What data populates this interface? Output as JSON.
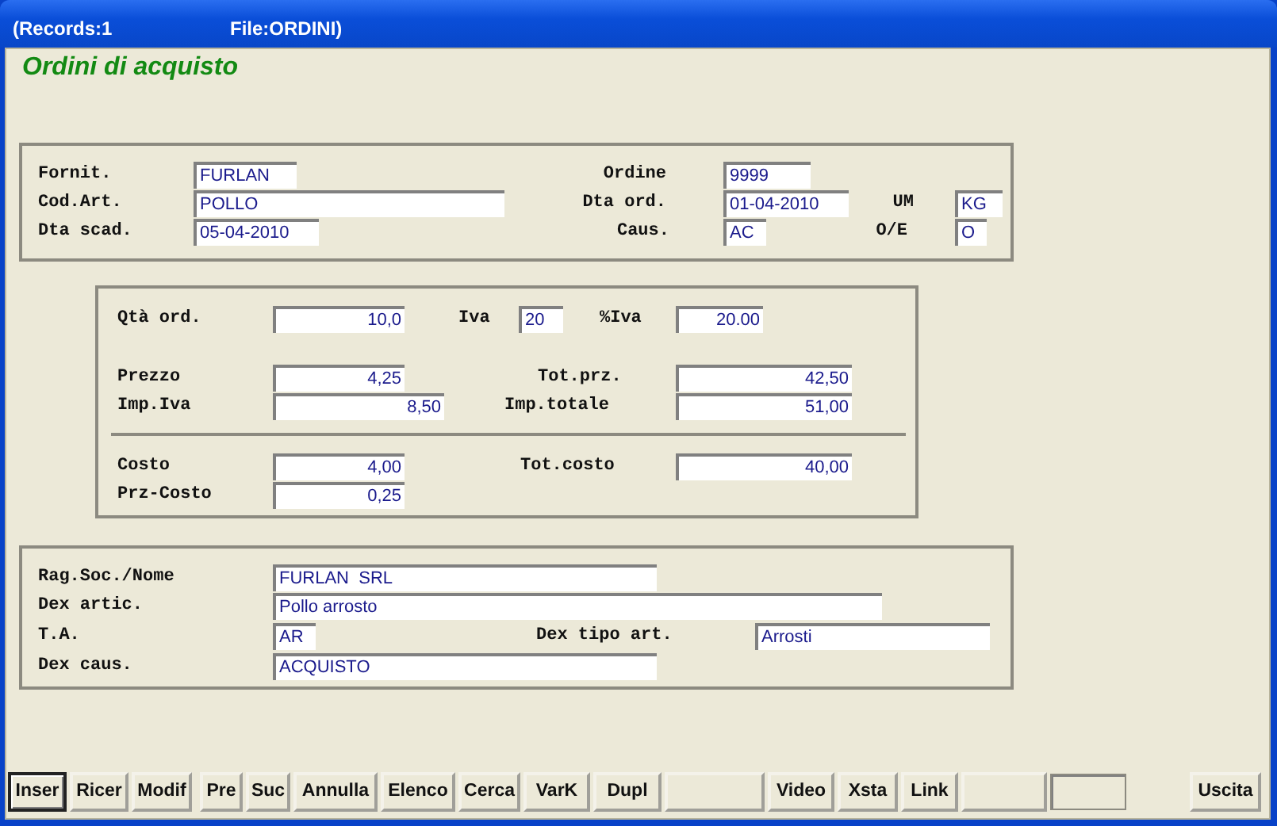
{
  "window": {
    "title_left": "(Records:1",
    "title_right": "File:ORDINI)"
  },
  "heading": "Ordini di acquisto",
  "header_fields": [
    {
      "label": "Fornit.",
      "value": "FURLAN"
    },
    {
      "label": "Ordine",
      "value": "9999"
    },
    {
      "label": "Cod.Art.",
      "value": "POLLO"
    },
    {
      "label": "Dta ord.",
      "value": "01-04-2010"
    },
    {
      "label": "UM",
      "value": "KG"
    },
    {
      "label": "Dta scad.",
      "value": "05-04-2010"
    },
    {
      "label": "Caus.",
      "value": "AC"
    },
    {
      "label": "O/E",
      "value": "O"
    }
  ],
  "amounts": [
    {
      "label": "Qtà ord.",
      "value": "10,0"
    },
    {
      "label": "Iva",
      "value": "20"
    },
    {
      "label": "%Iva",
      "value": "20.00"
    },
    {
      "label": "Prezzo",
      "value": "4,25"
    },
    {
      "label": "Tot.prz.",
      "value": "42,50"
    },
    {
      "label": "Imp.Iva",
      "value": "8,50"
    },
    {
      "label": "Imp.totale",
      "value": "51,00"
    },
    {
      "label": "Costo",
      "value": "4,00"
    },
    {
      "label": "Tot.costo",
      "value": "40,00"
    },
    {
      "label": "Prz-Costo",
      "value": "0,25"
    }
  ],
  "details": [
    {
      "label": "Rag.Soc./Nome",
      "value": "FURLAN  SRL"
    },
    {
      "label": "Dex artic.",
      "value": "Pollo arrosto"
    },
    {
      "label": "T.A.",
      "value": "AR"
    },
    {
      "label": "Dex tipo art.",
      "value": "Arrosti"
    },
    {
      "label": "Dex caus.",
      "value": "ACQUISTO"
    }
  ],
  "buttons": [
    {
      "kind": "action",
      "label": "Inser",
      "focused": true
    },
    {
      "kind": "action",
      "label": "Ricer",
      "focused": false
    },
    {
      "kind": "action",
      "label": "Modif",
      "focused": false
    },
    {
      "kind": "action",
      "label": "Pre",
      "focused": false
    },
    {
      "kind": "action",
      "label": "Suc",
      "focused": false
    },
    {
      "kind": "action",
      "label": "Annulla",
      "focused": false
    },
    {
      "kind": "action",
      "label": "Elenco",
      "focused": false
    },
    {
      "kind": "action",
      "label": "Cerca",
      "focused": false
    },
    {
      "kind": "action",
      "label": "VarK",
      "focused": false
    },
    {
      "kind": "action",
      "label": "Dupl",
      "focused": false
    },
    {
      "kind": "blank",
      "focused": false
    },
    {
      "kind": "action",
      "label": "Video",
      "focused": false
    },
    {
      "kind": "action",
      "label": "Xsta",
      "focused": false
    },
    {
      "kind": "action",
      "label": "Link",
      "focused": false
    },
    {
      "kind": "blank",
      "focused": false
    },
    {
      "kind": "sunken"
    },
    {
      "kind": "action",
      "label": "Uscita",
      "focused": false
    }
  ]
}
